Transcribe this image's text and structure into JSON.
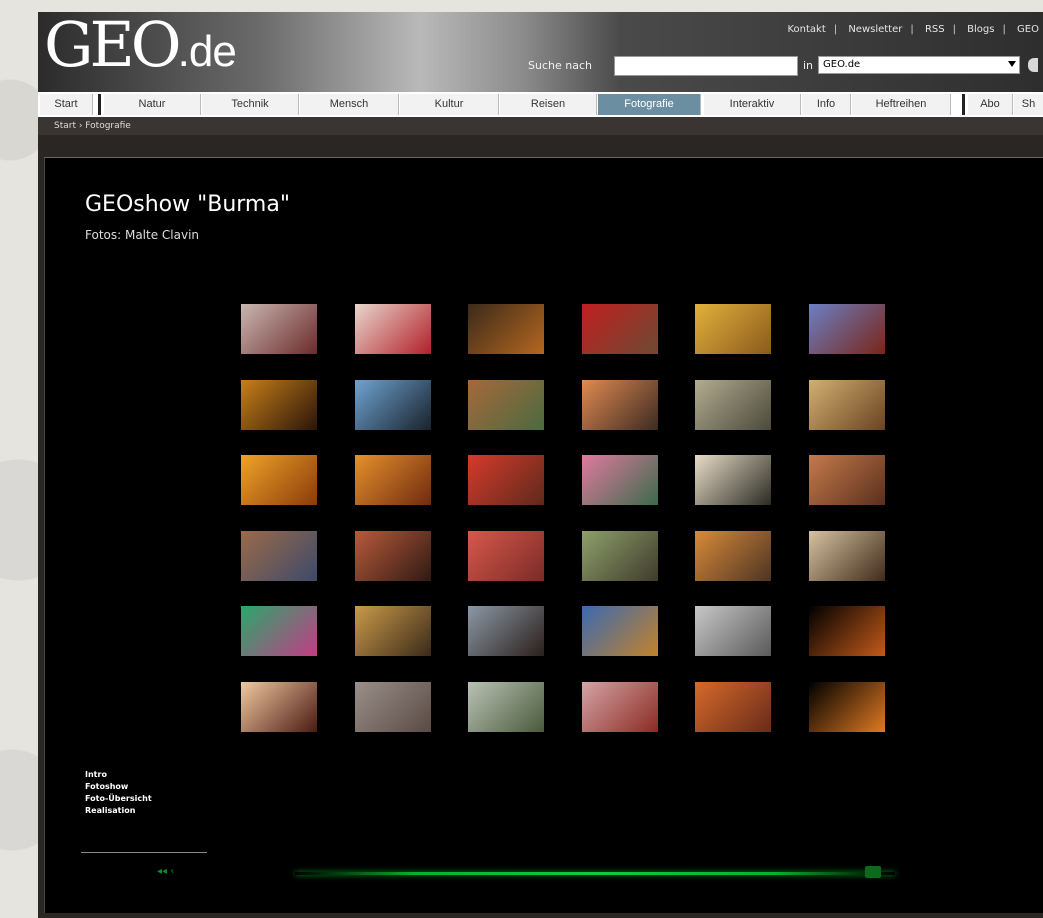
{
  "header": {
    "logo_main": "GEO",
    "logo_tld": ".de",
    "toplinks": [
      "Kontakt",
      "Newsletter",
      "RSS",
      "Blogs",
      "GEO"
    ],
    "search_label": "Suche nach",
    "search_placeholder": "",
    "in_label": "in",
    "scope_value": "GEO.de"
  },
  "nav": {
    "tabs": [
      "Start",
      "Natur",
      "Technik",
      "Mensch",
      "Kultur",
      "Reisen",
      "Fotografie",
      "Interaktiv",
      "Info",
      "Heftreihen",
      "Abo",
      "Sh"
    ],
    "active": "Fotografie"
  },
  "breadcrumb": "Start › Fotografie",
  "show": {
    "title": "GEOshow \"Burma\"",
    "subtitle": "Fotos: Malte Clavin",
    "side_links": [
      "Intro",
      "Fotoshow",
      "Foto-Übersicht",
      "Realisation"
    ],
    "thumbnails": [
      {
        "name": "pagoda-silhouette",
        "c1": "#c9b6b1",
        "c2": "#6a2b2b"
      },
      {
        "name": "children-red-headdress",
        "c1": "#e8d7cc",
        "c2": "#b31f2a"
      },
      {
        "name": "sunset-landscape",
        "c1": "#3b2a1a",
        "c2": "#b5671f"
      },
      {
        "name": "monks-red-robes",
        "c1": "#c01f1f",
        "c2": "#6d4a33"
      },
      {
        "name": "golden-field",
        "c1": "#e2b13b",
        "c2": "#8a5a1c"
      },
      {
        "name": "monk-blue-sky",
        "c1": "#6b7fc4",
        "c2": "#7a2517"
      },
      {
        "name": "candlelight-crowd",
        "c1": "#c77f1a",
        "c2": "#2a1509"
      },
      {
        "name": "fisherman-net",
        "c1": "#6fa3d1",
        "c2": "#18222c"
      },
      {
        "name": "market-crowd",
        "c1": "#a6683b",
        "c2": "#4a6b3f"
      },
      {
        "name": "women-group",
        "c1": "#e08a52",
        "c2": "#3b2a22"
      },
      {
        "name": "misty-river",
        "c1": "#b2ab8f",
        "c2": "#4b4a3b"
      },
      {
        "name": "golden-buddhas",
        "c1": "#d1b071",
        "c2": "#6a4322"
      },
      {
        "name": "golden-temple-interior",
        "c1": "#f0a328",
        "c2": "#8a3b0b"
      },
      {
        "name": "orange-shrine",
        "c1": "#e6902c",
        "c2": "#6f2b10"
      },
      {
        "name": "red-market-stall",
        "c1": "#d63a2a",
        "c2": "#5d2a1c"
      },
      {
        "name": "pink-dancers",
        "c1": "#e07aa0",
        "c2": "#3b6b4a"
      },
      {
        "name": "child-portrait",
        "c1": "#e8dcc8",
        "c2": "#2b2b23"
      },
      {
        "name": "temple-corridor",
        "c1": "#c47a4b",
        "c2": "#5a2f1d"
      },
      {
        "name": "pagoda-columns",
        "c1": "#9b6a4a",
        "c2": "#3d4a6a"
      },
      {
        "name": "red-cloth",
        "c1": "#b85a3b",
        "c2": "#2f1a12"
      },
      {
        "name": "monks-rows",
        "c1": "#d7584a",
        "c2": "#7a2b28"
      },
      {
        "name": "cattle-cart",
        "c1": "#8da06a",
        "c2": "#3f3b2b"
      },
      {
        "name": "dusty-plain",
        "c1": "#d88a3a",
        "c2": "#4d3424"
      },
      {
        "name": "monks-doorway",
        "c1": "#d6c2a0",
        "c2": "#3f2b1a"
      },
      {
        "name": "green-umbrellas",
        "c1": "#2aa86a",
        "c2": "#c33c86"
      },
      {
        "name": "market-table",
        "c1": "#c99a4a",
        "c2": "#3a2a1a"
      },
      {
        "name": "boat-dusk",
        "c1": "#8a98a6",
        "c2": "#2a1f1a"
      },
      {
        "name": "crowd-blue",
        "c1": "#3a6ab0",
        "c2": "#c3822a"
      },
      {
        "name": "misty-temples",
        "c1": "#c7c7c7",
        "c2": "#5a5a5a"
      },
      {
        "name": "dark-bonfire",
        "c1": "#000000",
        "c2": "#c45a1a"
      },
      {
        "name": "candle-shrine",
        "c1": "#f0c9a0",
        "c2": "#4a1a12"
      },
      {
        "name": "stupa-mist",
        "c1": "#9a8f8a",
        "c2": "#5a4a44"
      },
      {
        "name": "tree-temples",
        "c1": "#b9c2b5",
        "c2": "#4a5a3a"
      },
      {
        "name": "red-pagoda",
        "c1": "#d4a3a6",
        "c2": "#8a2b22"
      },
      {
        "name": "temple-evening",
        "c1": "#d56a2a",
        "c2": "#6a2a1a"
      },
      {
        "name": "fire-night",
        "c1": "#000000",
        "c2": "#e07a22"
      }
    ]
  }
}
